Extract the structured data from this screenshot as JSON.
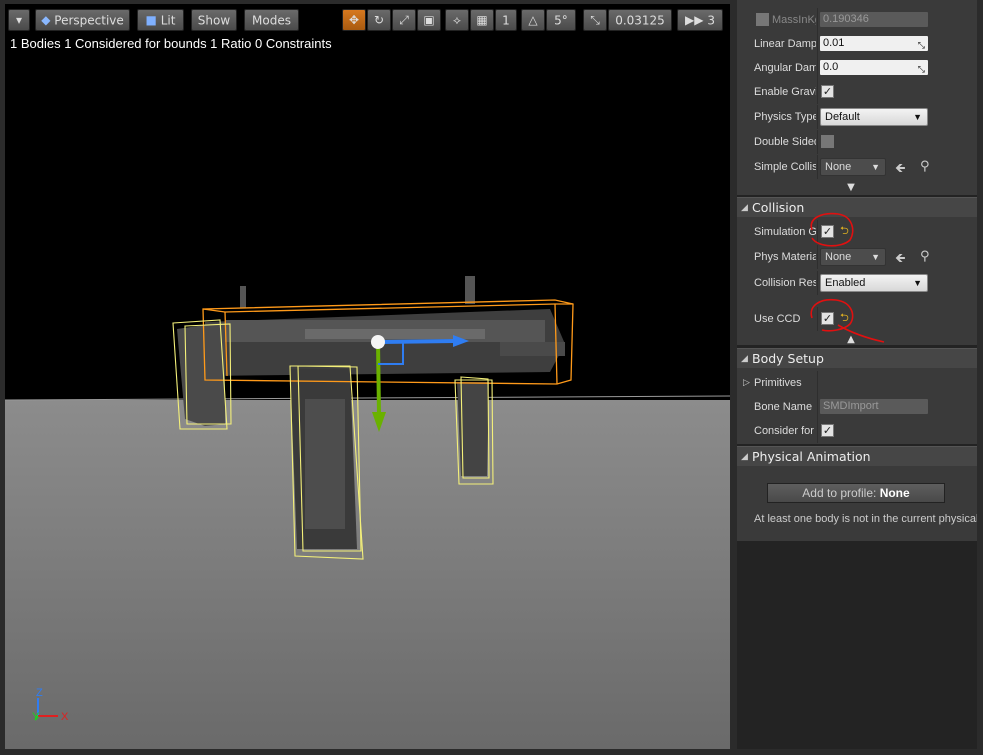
{
  "viewport": {
    "toolbar": {
      "perspective_label": "Perspective",
      "lit_label": "Lit",
      "show_label": "Show",
      "modes_label": "Modes",
      "grid_snap_value": "1",
      "rotation_snap_value": "5°",
      "scale_snap_value": "0.03125",
      "camera_speed_value": "3"
    },
    "stats": "1 Bodies  1 Considered for bounds  1 Ratio  0 Constraints",
    "axis": {
      "x": "X",
      "y": "Y",
      "z": "Z"
    }
  },
  "panel": {
    "physics": {
      "rows": [
        {
          "label": "MassInKg",
          "value": "0.190346"
        },
        {
          "label": "Linear Damping",
          "value": "0.01"
        },
        {
          "label": "Angular Damping",
          "value": "0.0"
        },
        {
          "label": "Enable Gravity"
        },
        {
          "label": "Physics Type",
          "value": "Default"
        },
        {
          "label": "Double Sided"
        },
        {
          "label": "Simple Collision",
          "value": "None"
        }
      ]
    },
    "collision": {
      "title": "Collision",
      "rows": [
        {
          "label": "Simulation Generates Hit Events"
        },
        {
          "label": "Phys Material Override",
          "value": "None"
        },
        {
          "label": "Collision Response",
          "value": "Enabled"
        },
        {
          "label": "Use CCD"
        }
      ]
    },
    "body_setup": {
      "title": "Body Setup",
      "rows": [
        {
          "label": "Primitives"
        },
        {
          "label": "Bone Name",
          "value": "SMDImport"
        },
        {
          "label": "Consider for Bounds"
        }
      ]
    },
    "physical_animation": {
      "title": "Physical Animation",
      "add_button_prefix": "Add to profile: ",
      "add_button_profile": "None",
      "note": "At least one body is not in the current physical animation profile"
    }
  },
  "colors": {
    "accent_orange": "#d7791f",
    "annotation_red": "#e01010",
    "selection_orange": "#ff9a1a",
    "body_yellow": "#f4f07a"
  }
}
